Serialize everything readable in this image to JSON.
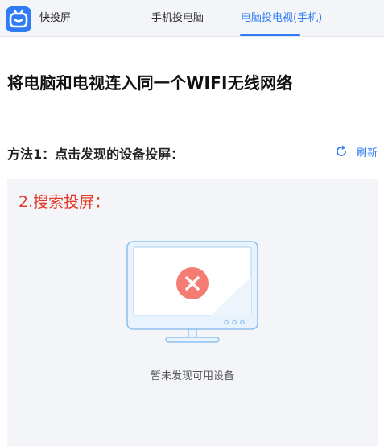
{
  "header": {
    "app_name": "快投屏",
    "logo_icon": "tv-logo-icon",
    "tabs": [
      {
        "label": "手机投电脑",
        "active": false
      },
      {
        "label": "电脑投电视(手机)",
        "active": true
      }
    ]
  },
  "main": {
    "headline": "将电脑和电视连入同一个WIFI无线网络",
    "method_title": "方法1：点击发现的设备投屏：",
    "refresh_label": "刷新",
    "refresh_icon": "refresh-icon"
  },
  "device_panel": {
    "search_label": "2.搜索投屏：",
    "monitor_icon": "monitor-error-icon",
    "empty_text": "暂未发现可用设备"
  },
  "colors": {
    "accent": "#2f7cf6",
    "warning_text": "#e53a2a",
    "error_badge": "#f47c72",
    "panel_bg": "#f3f5f8"
  }
}
